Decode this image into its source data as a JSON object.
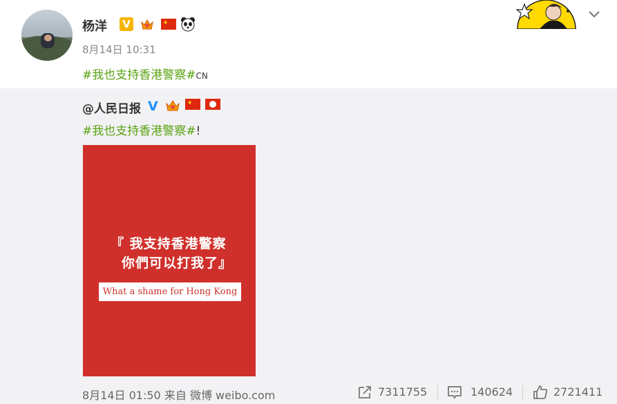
{
  "post": {
    "username": "杨洋",
    "time": "8月14日 10:31",
    "topic": "#我也支持香港警察#",
    "topic_suffix": "CN"
  },
  "repost": {
    "author": "@人民日报",
    "topic": "#我也支持香港警察#",
    "topic_suffix": "!",
    "image": {
      "line1": "『 我支持香港警察",
      "line2": "你們可以打我了』",
      "caption": "What a shame for Hong Kong"
    },
    "footer": {
      "time": "8月14日 01:50",
      "source_prefix": "来自",
      "source": "微博 weibo.com"
    },
    "actions": {
      "reposts": "7311755",
      "comments": "140624",
      "likes": "2721411"
    }
  },
  "colors": {
    "topic_green": "#5aa212",
    "poster_red": "#d0302b",
    "verified_orange": "#f7b500",
    "verified_blue": "#1e90ff"
  },
  "icons": [
    "orange-v-badge-icon",
    "crown-badge-icon",
    "china-flag-icon",
    "panda-icon",
    "chevron-down-icon",
    "blue-v-badge-icon",
    "hong-kong-flag-icon",
    "repost-icon",
    "comment-icon",
    "like-icon"
  ]
}
